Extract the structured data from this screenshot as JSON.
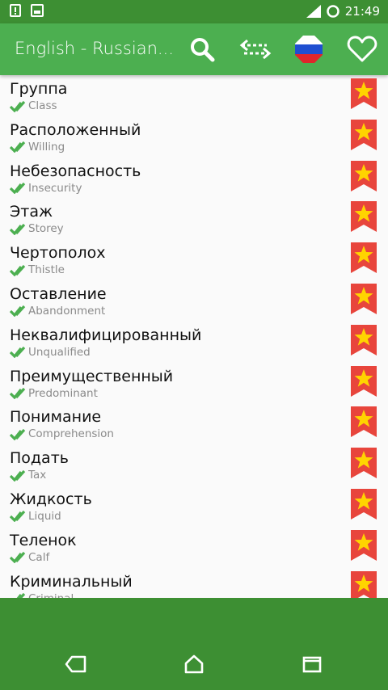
{
  "status_bar": {
    "time": "21:49"
  },
  "app_bar": {
    "title": "English - Russian..."
  },
  "colors": {
    "primary": "#4caf50",
    "primary_dark": "#3d8f33",
    "bookmark": "#e8453c",
    "star": "#ffd400",
    "check": "#4caf50"
  },
  "icons": {
    "search": "search-icon",
    "swap": "swap-icon",
    "flag": "russian-flag-icon",
    "favorite": "heart-icon",
    "bookmark": "bookmark-star-icon",
    "check": "double-check-icon"
  },
  "words": [
    {
      "word": "Группа",
      "translation": "Class"
    },
    {
      "word": "Расположенный",
      "translation": "Willing"
    },
    {
      "word": "Небезопасность",
      "translation": "Insecurity"
    },
    {
      "word": "Этаж",
      "translation": "Storey"
    },
    {
      "word": "Чертополох",
      "translation": "Thistle"
    },
    {
      "word": "Оставление",
      "translation": "Abandonment"
    },
    {
      "word": "Неквалифицированный",
      "translation": "Unqualified"
    },
    {
      "word": "Преимущественный",
      "translation": "Predominant"
    },
    {
      "word": "Понимание",
      "translation": "Comprehension"
    },
    {
      "word": "Подать",
      "translation": "Tax"
    },
    {
      "word": "Жидкость",
      "translation": "Liquid"
    },
    {
      "word": "Теленок",
      "translation": "Calf"
    },
    {
      "word": "Криминальный",
      "translation": "Criminal"
    }
  ]
}
